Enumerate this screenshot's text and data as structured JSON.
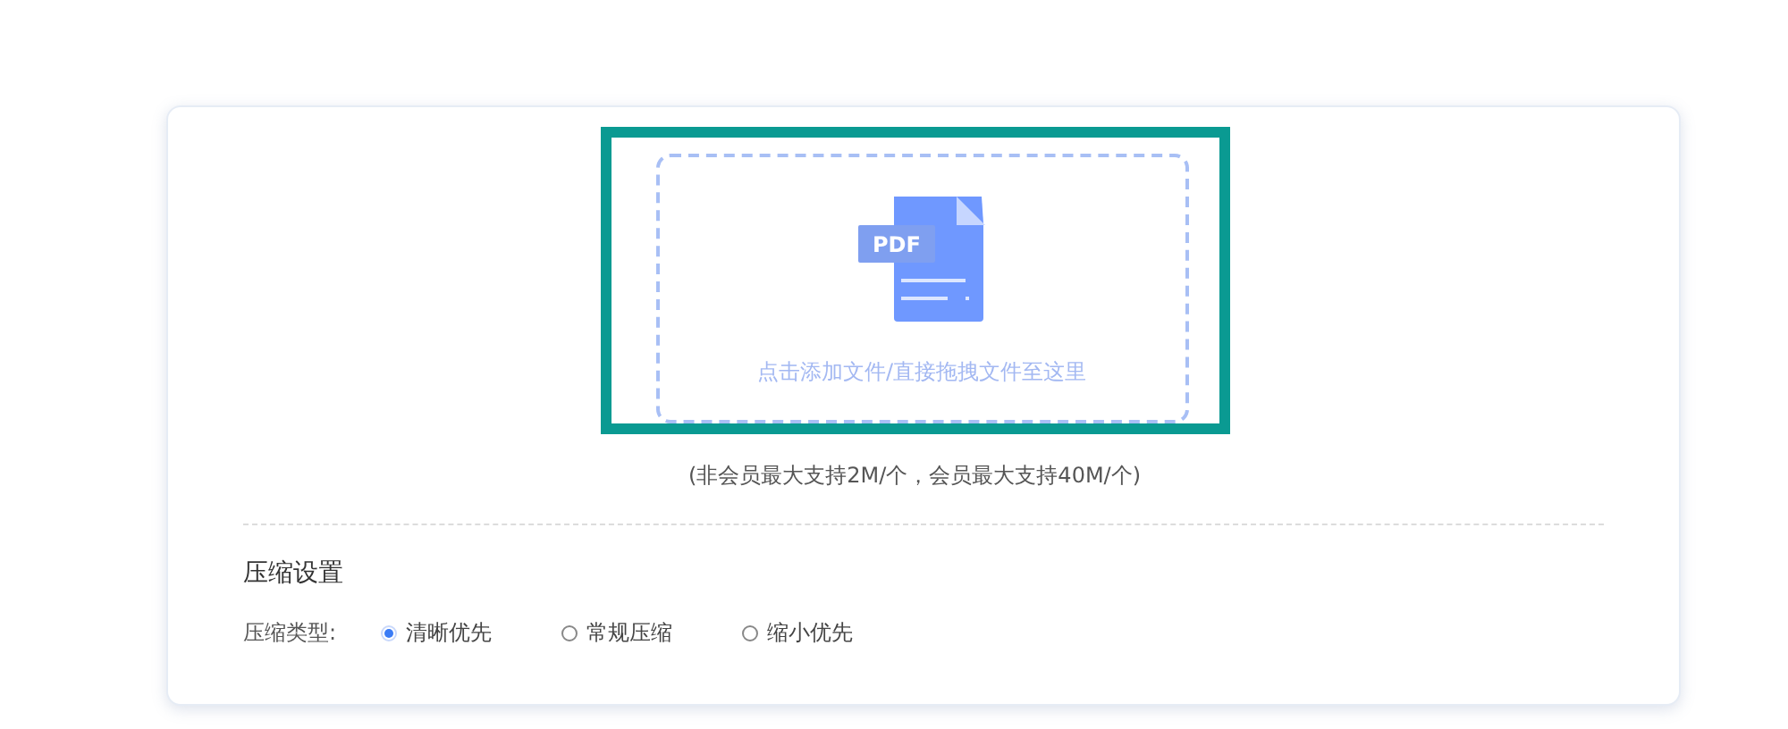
{
  "upload": {
    "badge": "PDF",
    "hint": "点击添加文件/直接拖拽文件至这里",
    "highlighted": true
  },
  "limit_note": "(非会员最大支持2M/个，会员最大支持40M/个)",
  "settings": {
    "title": "压缩设置",
    "label": "压缩类型:",
    "options": [
      {
        "label": "清晰优先",
        "selected": true
      },
      {
        "label": "常规压缩",
        "selected": false
      },
      {
        "label": "缩小优先",
        "selected": false
      }
    ]
  }
}
